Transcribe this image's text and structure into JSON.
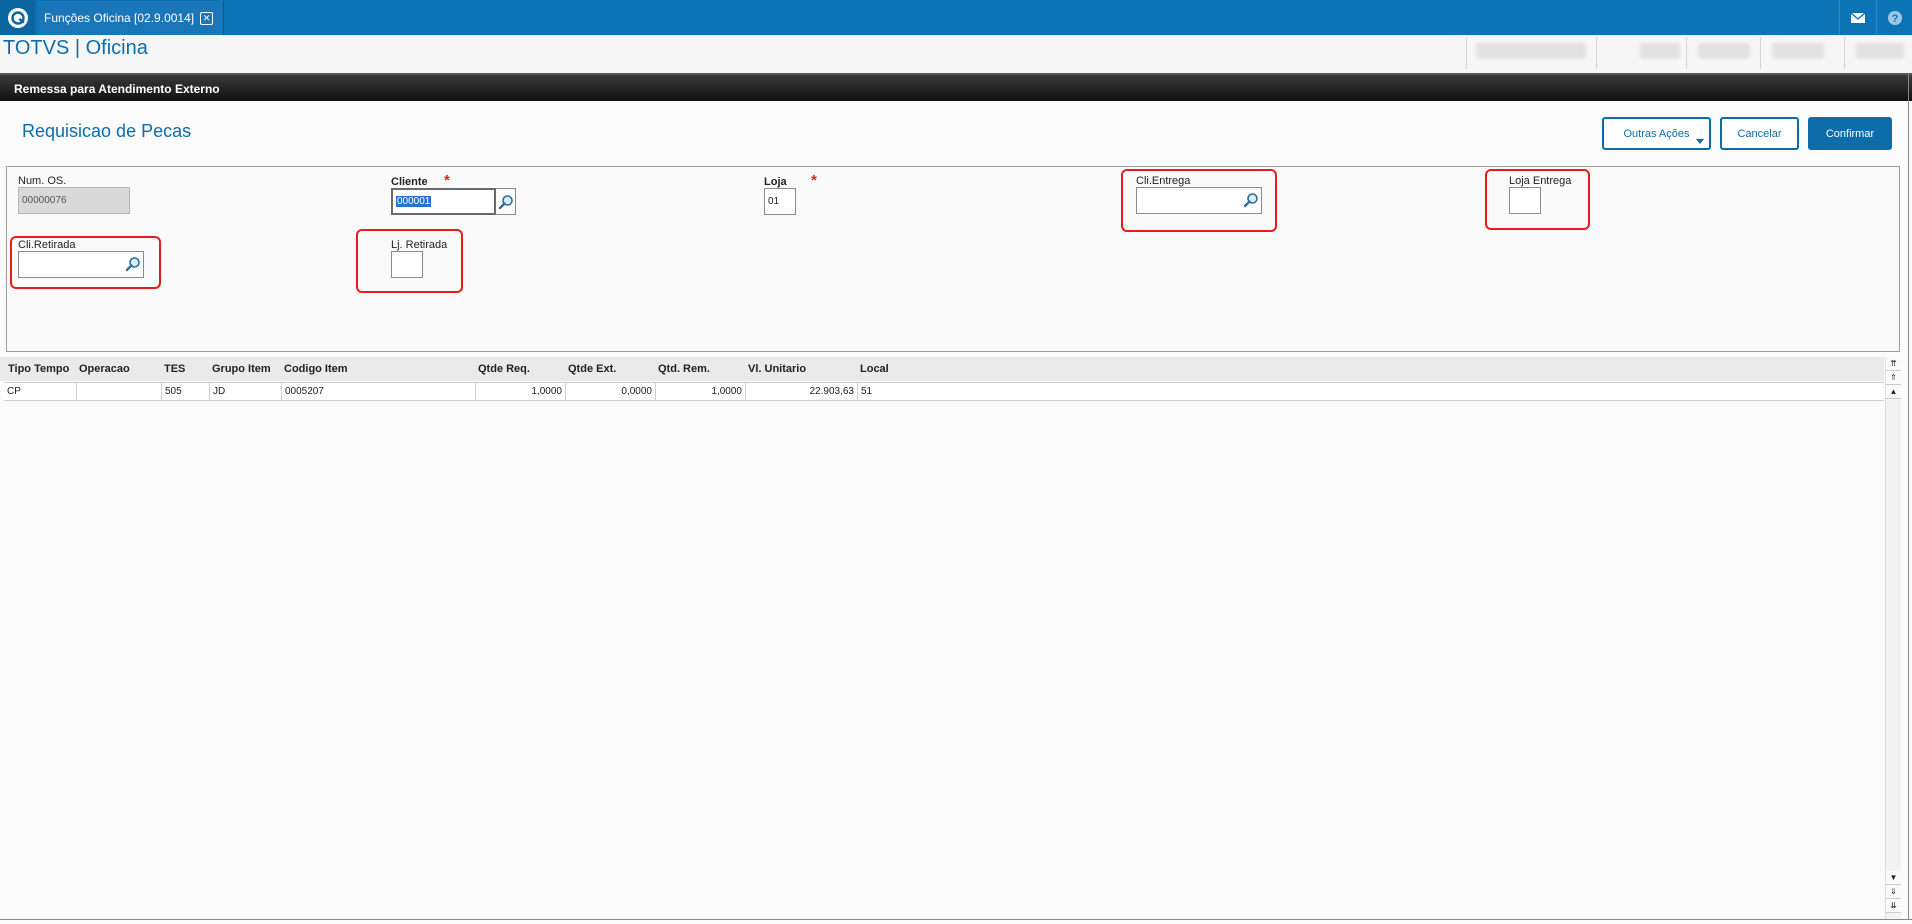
{
  "window": {
    "tab_title": "Funções Oficina [02.9.0014]",
    "close_glyph": "✕"
  },
  "app": {
    "title": "TOTVS | Oficina"
  },
  "header": {
    "title": "Remessa para Atendimento Externo"
  },
  "page": {
    "subtitle": "Requisicao de Pecas"
  },
  "actions": {
    "more": "Outras Ações",
    "cancel": "Cancelar",
    "confirm": "Confirmar"
  },
  "form": {
    "num_os": {
      "label": "Num. OS.",
      "value": "00000076"
    },
    "cliente": {
      "label": "Cliente",
      "value": "000001",
      "required": "*"
    },
    "loja": {
      "label": "Loja",
      "value": "01",
      "required": "*"
    },
    "cli_entrega": {
      "label": "Cli.Entrega",
      "value": ""
    },
    "loja_entrega": {
      "label": "Loja Entrega",
      "value": ""
    },
    "cli_retirada": {
      "label": "Cli.Retirada",
      "value": ""
    },
    "lj_retirada": {
      "label": "Lj. Retirada",
      "value": ""
    }
  },
  "grid": {
    "columns": [
      "Tipo Tempo",
      "Operacao",
      "TES",
      "Grupo Item",
      "Codigo Item",
      "Qtde Req.",
      "Qtde Ext.",
      "Qtd. Rem.",
      "Vl. Unitario",
      "Local"
    ],
    "rows": [
      [
        "CP",
        "",
        "505",
        "JD",
        "0005207",
        "1,0000",
        "0,0000",
        "1,0000",
        "22.903,63",
        "51"
      ]
    ]
  },
  "scroll": {
    "top": "⇈",
    "page_up": "⇑",
    "up": "▲",
    "down": "▼",
    "page_down": "⇓",
    "bottom": "⇊"
  },
  "colors": {
    "brand": "#0c73b5",
    "accent_text": "#0d6dab",
    "highlight": "#e81c1c"
  },
  "icons": [
    "totvs-logo-icon",
    "close-icon",
    "mail-icon",
    "help-icon",
    "search-icon"
  ]
}
